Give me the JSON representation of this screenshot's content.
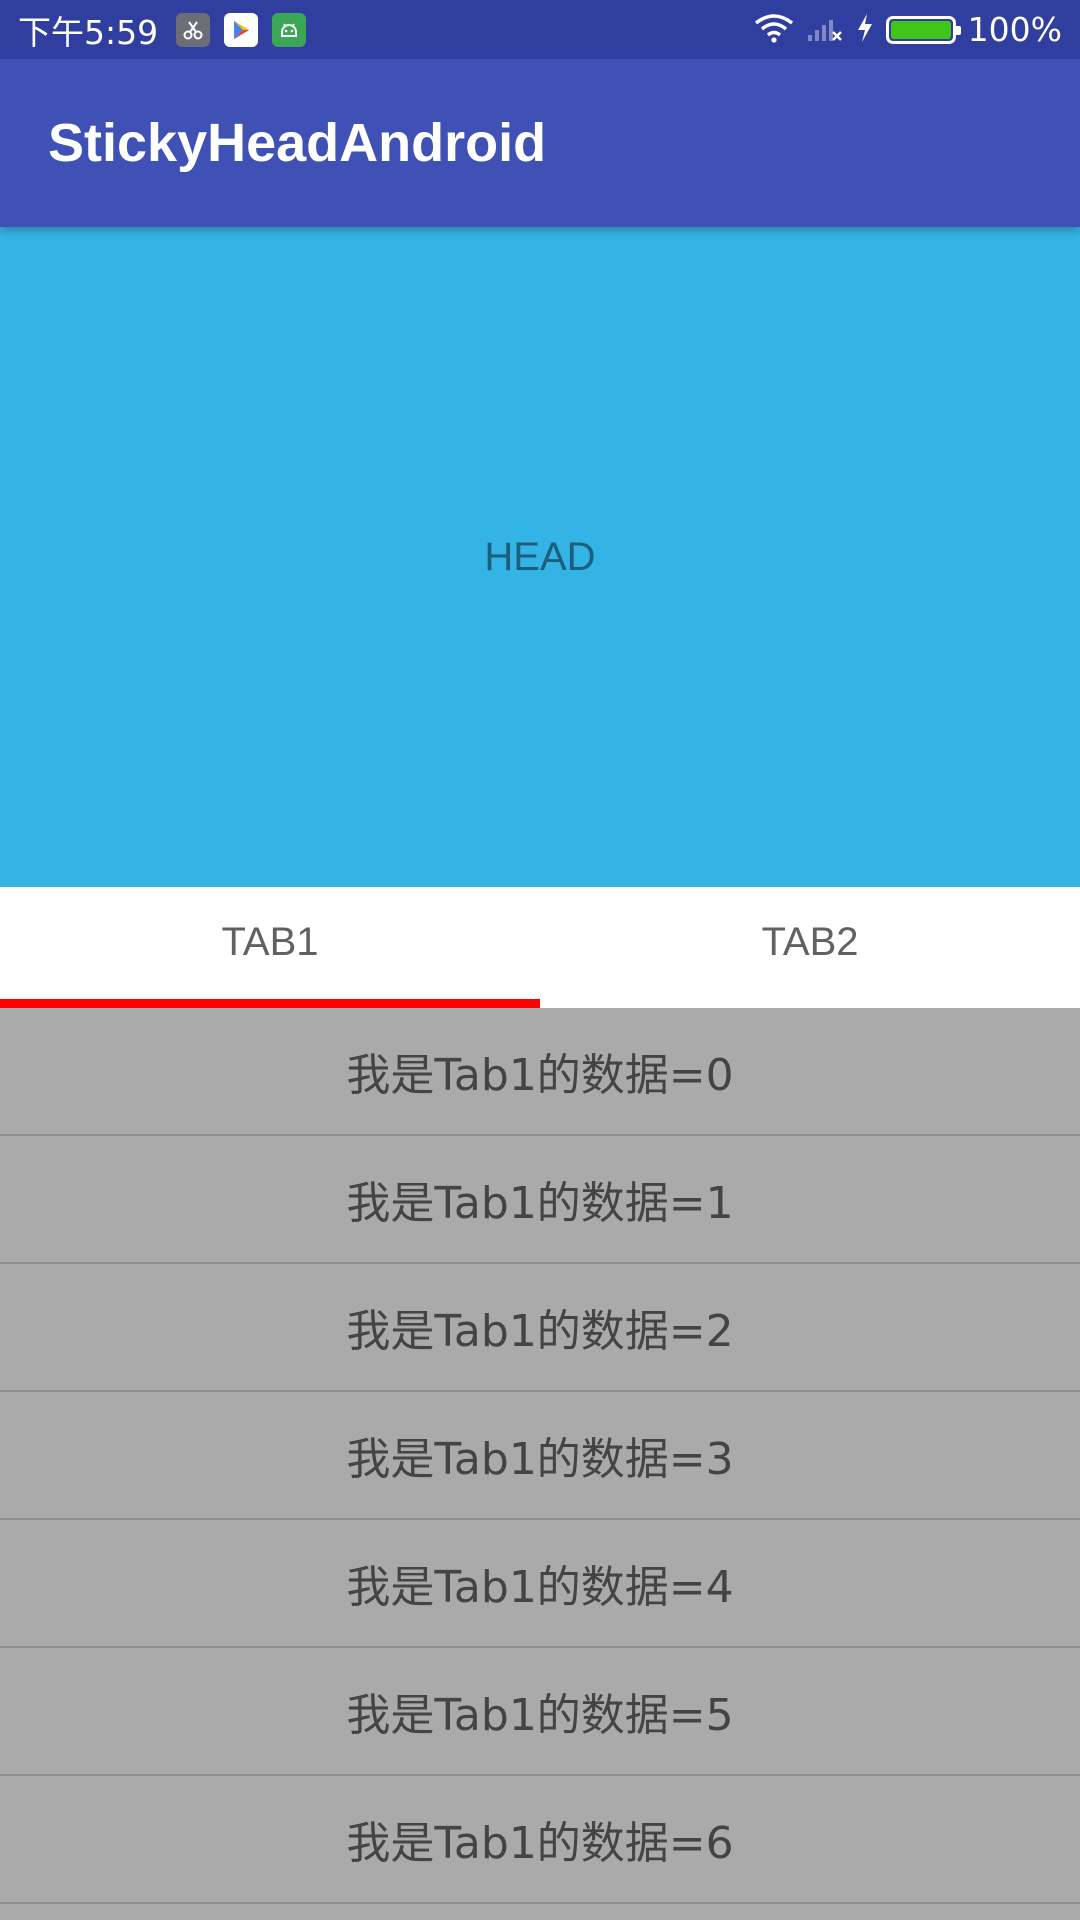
{
  "status_bar": {
    "time": "下午5:59",
    "notification_icons": [
      "scissors-icon",
      "play-store-icon",
      "android-icon"
    ],
    "battery_percent": "100%",
    "battery_level": 1.0
  },
  "app_bar": {
    "title": "StickyHeadAndroid"
  },
  "head": {
    "label": "HEAD"
  },
  "tabs": [
    {
      "label": "TAB1",
      "selected": true
    },
    {
      "label": "TAB2",
      "selected": false
    }
  ],
  "list": {
    "items": [
      "我是Tab1的数据=0",
      "我是Tab1的数据=1",
      "我是Tab1的数据=2",
      "我是Tab1的数据=3",
      "我是Tab1的数据=4",
      "我是Tab1的数据=5",
      "我是Tab1的数据=6"
    ]
  },
  "colors": {
    "status_bar": "#303f9f",
    "app_bar": "#3f51b5",
    "head_background": "#34b4e4",
    "tab_indicator": "#ff0000",
    "list_background": "#aaaaaa"
  }
}
